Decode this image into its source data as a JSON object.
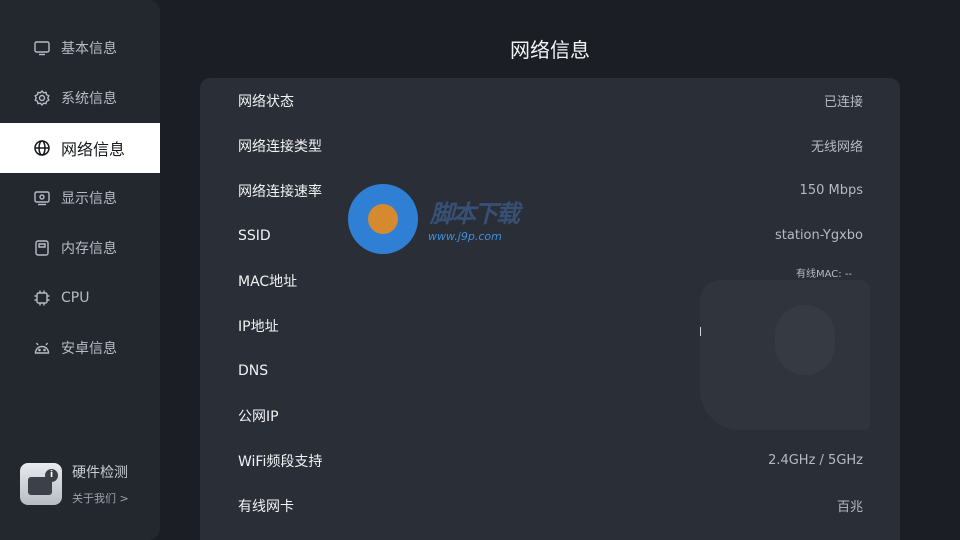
{
  "sidebar": {
    "items": [
      {
        "label": "基本信息",
        "icon": "monitor-icon"
      },
      {
        "label": "系统信息",
        "icon": "gear-icon"
      },
      {
        "label": "网络信息",
        "icon": "globe-icon",
        "active": true
      },
      {
        "label": "显示信息",
        "icon": "display-icon"
      },
      {
        "label": "内存信息",
        "icon": "memory-icon"
      },
      {
        "label": "CPU",
        "icon": "cpu-icon"
      },
      {
        "label": "安卓信息",
        "icon": "android-icon"
      }
    ],
    "app_card": {
      "title": "硬件检测",
      "link": "关于我们 >",
      "badge": "i"
    }
  },
  "main": {
    "title": "网络信息",
    "rows": [
      {
        "label": "网络状态",
        "value": "已连接"
      },
      {
        "label": "网络连接类型",
        "value": "无线网络"
      },
      {
        "label": "网络连接速率",
        "value": "150 Mbps"
      },
      {
        "label": "SSID",
        "value": "station-Ygxbo"
      },
      {
        "label": "MAC地址",
        "value": ""
      },
      {
        "label": "IP地址",
        "value": ""
      },
      {
        "label": "DNS",
        "value": ""
      },
      {
        "label": "公网IP",
        "value": ""
      },
      {
        "label": "WiFi频段支持",
        "value": "2.4GHz / 5GHz"
      },
      {
        "label": "有线网卡",
        "value": "百兆"
      }
    ],
    "mac_note": "有线MAC: --"
  },
  "watermark": {
    "text": "脚本下载",
    "url": "www.j9p.com"
  },
  "colors": {
    "background": "#1b1e24",
    "sidebar": "#23272e",
    "panel": "#2a2e36",
    "active_bg": "#ffffff"
  }
}
